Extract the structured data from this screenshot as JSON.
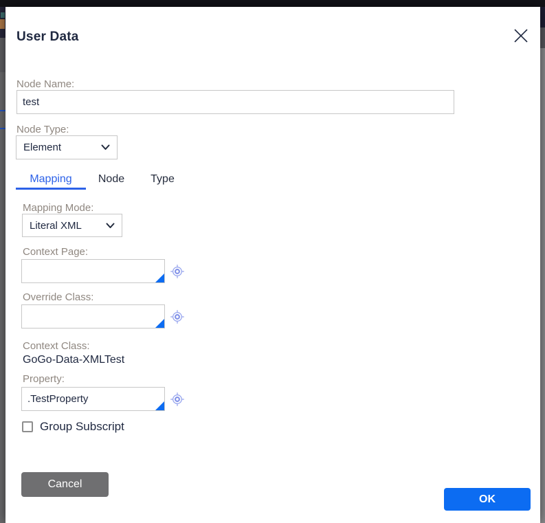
{
  "dialog": {
    "title": "User Data"
  },
  "form": {
    "node_name": {
      "label": "Node Name:",
      "value": "test"
    },
    "node_type": {
      "label": "Node Type:",
      "value": "Element"
    },
    "tabs": [
      {
        "label": "Mapping",
        "active": true
      },
      {
        "label": "Node",
        "active": false
      },
      {
        "label": "Type",
        "active": false
      }
    ],
    "mapping": {
      "mapping_mode": {
        "label": "Mapping Mode:",
        "value": "Literal XML"
      },
      "context_page": {
        "label": "Context Page:",
        "value": ""
      },
      "override_class": {
        "label": "Override Class:",
        "value": ""
      },
      "context_class": {
        "label": "Context Class:",
        "value": "GoGo-Data-XMLTest"
      },
      "property": {
        "label": "Property:",
        "value": ".TestProperty"
      },
      "group_subscript": {
        "label": "Group Subscript",
        "checked": false
      }
    }
  },
  "actions": {
    "cancel": "Cancel",
    "ok": "OK"
  },
  "icons": {
    "close": "close-icon",
    "chevron": "chevron-down-icon",
    "target": "target-crosshair-icon",
    "corner": "smart-prompt-corner-triangle"
  },
  "colors": {
    "accent_blue": "#0c6cf2",
    "active_tab_blue": "#2d62e8",
    "icon_lavender": "#98a6ee",
    "cancel_gray": "#6f6f71",
    "label_gray": "#8f8780",
    "text_navy": "#1f2840"
  }
}
